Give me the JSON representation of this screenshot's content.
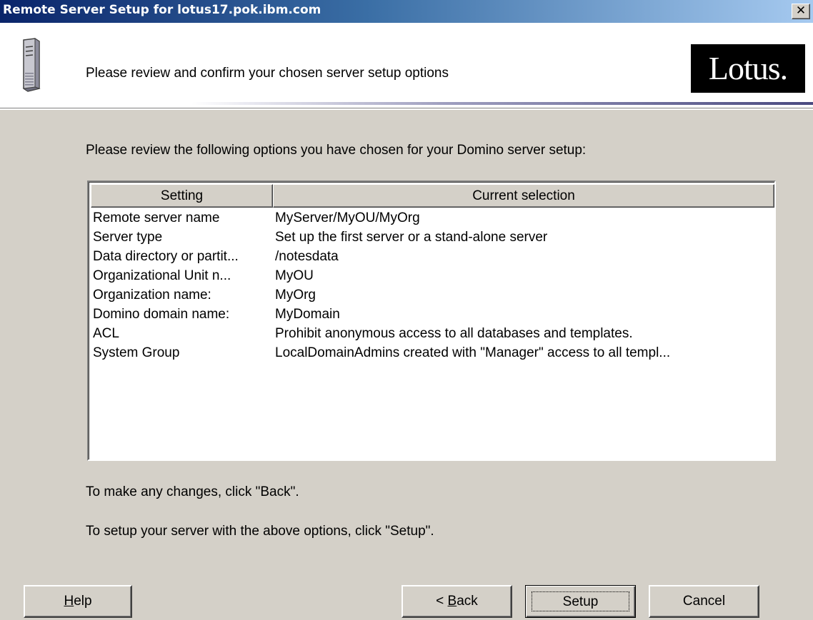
{
  "window": {
    "title": "Remote Server Setup for lotus17.pok.ibm.com",
    "close_glyph": "✕"
  },
  "header": {
    "text": "Please review and confirm your chosen server setup options",
    "logo_text": "Lotus.",
    "icon": "server-icon"
  },
  "intro": "Please review the following options you have chosen for your Domino server setup:",
  "table": {
    "columns": [
      "Setting",
      "Current selection"
    ],
    "rows": [
      {
        "setting": "Remote server name",
        "value": "MyServer/MyOU/MyOrg"
      },
      {
        "setting": "Server type",
        "value": "Set up the first server or a stand-alone server"
      },
      {
        "setting": "Data directory or partit...",
        "value": "/notesdata"
      },
      {
        "setting": "Organizational Unit n...",
        "value": "MyOU"
      },
      {
        "setting": "Organization name:",
        "value": "MyOrg"
      },
      {
        "setting": "Domino domain name:",
        "value": "MyDomain"
      },
      {
        "setting": "ACL",
        "value": "Prohibit  anonymous access to all databases and templates."
      },
      {
        "setting": "System Group",
        "value": "LocalDomainAdmins created with \"Manager\" access to all templ..."
      }
    ]
  },
  "notes": {
    "back_note": "To make any changes, click \"Back\".",
    "setup_note": "To setup your server with the above options, click \"Setup\"."
  },
  "buttons": {
    "help_mnemonic": "H",
    "help_rest": "elp",
    "back_prefix": "< ",
    "back_mnemonic": "B",
    "back_rest": "ack",
    "setup": "Setup",
    "cancel": "Cancel"
  }
}
